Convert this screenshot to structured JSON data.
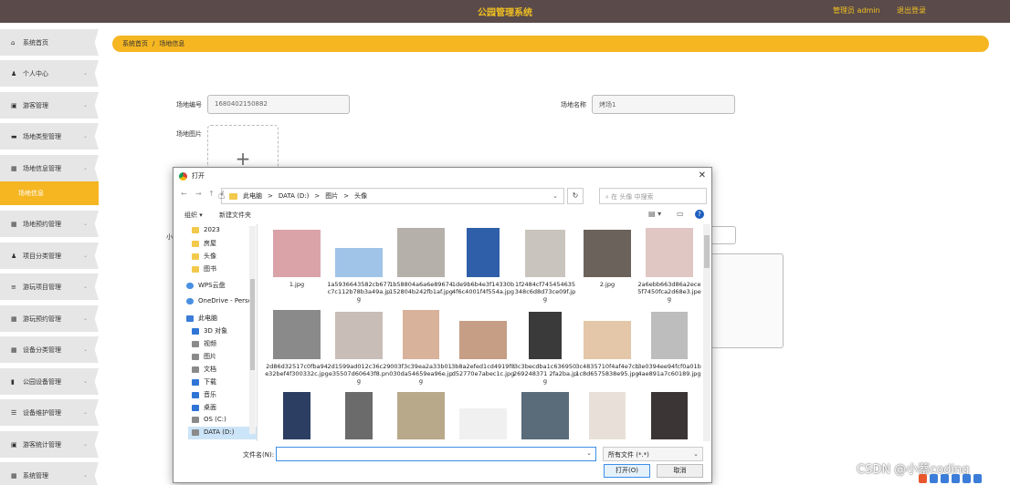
{
  "header": {
    "title": "公园管理系统",
    "user": "管理员 admin",
    "logout": "退出登录"
  },
  "sidebar": {
    "items": [
      {
        "label": "系统首页",
        "icon": "home-icon",
        "glyph": "⌂",
        "chevron": false
      },
      {
        "label": "个人中心",
        "icon": "person-icon",
        "glyph": "♟",
        "chevron": true
      },
      {
        "label": "游客管理",
        "icon": "bag-icon",
        "glyph": "▣",
        "chevron": true
      },
      {
        "label": "场地类型管理",
        "icon": "monitor-icon",
        "glyph": "▬",
        "chevron": true
      },
      {
        "label": "场地信息管理",
        "icon": "grid-icon",
        "glyph": "▦",
        "chevron": true
      },
      {
        "label": "场地预约管理",
        "icon": "grid-icon",
        "glyph": "▦",
        "chevron": true
      },
      {
        "label": "项目分类管理",
        "icon": "person-icon",
        "glyph": "♟",
        "chevron": true
      },
      {
        "label": "游玩项目管理",
        "icon": "list-icon",
        "glyph": "≡",
        "chevron": true
      },
      {
        "label": "游玩预约管理",
        "icon": "grid-icon",
        "glyph": "▦",
        "chevron": true
      },
      {
        "label": "设备分类管理",
        "icon": "grid-icon",
        "glyph": "▦",
        "chevron": true
      },
      {
        "label": "公园设备管理",
        "icon": "chart-icon",
        "glyph": "▮",
        "chevron": true
      },
      {
        "label": "设备维护管理",
        "icon": "sliders-icon",
        "glyph": "☰",
        "chevron": true
      },
      {
        "label": "游客统计管理",
        "icon": "bag-icon",
        "glyph": "▣",
        "chevron": true
      },
      {
        "label": "系统管理",
        "icon": "grid-icon",
        "glyph": "▦",
        "chevron": true
      }
    ],
    "active_sub": "场地信息"
  },
  "breadcrumb": {
    "home": "系统首页",
    "separator": "/",
    "current": "场地信息"
  },
  "form": {
    "code_label": "场地编号",
    "code_value": "1680402150882",
    "name_label": "场地名称",
    "name_value": "烤场1",
    "image_label": "场地图片",
    "cut_label": "小"
  },
  "dialog": {
    "title": "打开",
    "path": [
      "此电脑",
      ">",
      "DATA (D:)",
      ">",
      "图片",
      ">",
      "头像"
    ],
    "search_placeholder": "在 头像 中搜索",
    "organize": "组织 ▾",
    "new_folder": "新建文件夹",
    "tree": [
      {
        "label": "2023",
        "icon": "folder"
      },
      {
        "label": "房屋",
        "icon": "folder"
      },
      {
        "label": "头像",
        "icon": "folder"
      },
      {
        "label": "图书",
        "icon": "folder"
      },
      {
        "label": "WPS云盘",
        "icon": "cloud"
      },
      {
        "label": "OneDrive - Perso",
        "icon": "cloud"
      },
      {
        "label": "此电脑",
        "icon": "pc"
      },
      {
        "label": "3D 对象",
        "icon": "blue"
      },
      {
        "label": "视频",
        "icon": "grey"
      },
      {
        "label": "图片",
        "icon": "grey"
      },
      {
        "label": "文档",
        "icon": "grey"
      },
      {
        "label": "下载",
        "icon": "blue"
      },
      {
        "label": "音乐",
        "icon": "blue"
      },
      {
        "label": "桌面",
        "icon": "blue"
      },
      {
        "label": "OS (C:)",
        "icon": "grey"
      },
      {
        "label": "DATA (D:)",
        "icon": "grey"
      }
    ],
    "files": [
      {
        "name": "1.jpg",
        "color": "#d9a3a8"
      },
      {
        "name": "1a5936643582cb677c7c112b78b3a49a.jpg",
        "color": "#9fc4e8"
      },
      {
        "name": "1b58804a6a6e89674152804b242fb1af.jpg",
        "color": "#b5b0aa"
      },
      {
        "name": "1de9b6b4e3f14330b4f6c4001f4f554a.jpg",
        "color": "#2f5fa8"
      },
      {
        "name": "1f2484cf745454635348c6d8d73ce09f.jpg",
        "color": "#c9c4bd"
      },
      {
        "name": "2.jpg",
        "color": "#6b625c"
      },
      {
        "name": "2a6ebb663d86a2ece5f7450fca2d68e3.jpeg",
        "color": "#e0c7c3"
      },
      {
        "name": "2d86d32517c0fba94e32bef4f300332c.jpg",
        "color": "#8a8a8a"
      },
      {
        "name": "2d1599ad012c36c29e35507d60643f8.png",
        "color": "#c9bdb8"
      },
      {
        "name": "003f3c39ea2a33b01030da54659ea96e.jpg",
        "color": "#d8b29a"
      },
      {
        "name": "3b8a2efed1cd4919f8d52770e7abec1c.jpg",
        "color": "#c69d85"
      },
      {
        "name": "3c3becdba1c636950269248371 2fa2ba.jpg",
        "color": "#3a3a3a"
      },
      {
        "name": "3c4835710f4af4e7cb1c8d6575838e95.jpg",
        "color": "#e3c7a8"
      },
      {
        "name": "3e0394ee94fcf0a01b4ae891a7c60189.jpg",
        "color": "#bdbdbd"
      },
      {
        "name": "",
        "color": "#2c3e62"
      },
      {
        "name": "",
        "color": "#6b6b6b"
      },
      {
        "name": "",
        "color": "#b8a98a"
      },
      {
        "name": "",
        "color": "#f0f0f0"
      },
      {
        "name": "",
        "color": "#5a6b7a"
      },
      {
        "name": "",
        "color": "#e8e0d8"
      },
      {
        "name": "",
        "color": "#3b3535"
      }
    ],
    "filename_label": "文件名(N):",
    "filetype": "所有文件 (*.*)",
    "open_button": "打开(O)",
    "cancel_button": "取消"
  },
  "watermark": "CSDN @小蔡coding"
}
